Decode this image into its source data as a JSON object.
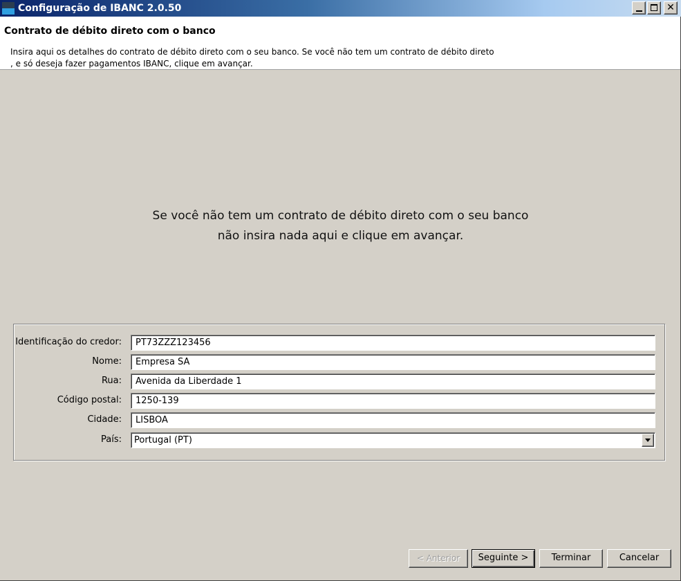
{
  "window": {
    "title": "Configuração de IBANC 2.0.50",
    "minimize_icon": "minimize-icon",
    "maximize_icon": "maximize-icon",
    "close_icon": "close-icon",
    "close_glyph": "✕"
  },
  "header": {
    "title": "Contrato de débito direto com o banco",
    "description_line1": "Insira aqui os detalhes do contrato de débito direto com o seu banco. Se você não tem um contrato de débito direto",
    "description_line2": ", e só deseja fazer pagamentos IBANC, clique em avançar."
  },
  "message": {
    "line1": "Se você não tem um contrato de débito direto com o seu banco",
    "line2": "não insira nada aqui e clique em avançar."
  },
  "form": {
    "creditor_id": {
      "label": "Identificação do credor:",
      "value": "PT73ZZZ123456"
    },
    "name": {
      "label": "Nome:",
      "value": "Empresa SA"
    },
    "street": {
      "label": "Rua:",
      "value": "Avenida da Liberdade 1"
    },
    "postal_code": {
      "label": "Código postal:",
      "value": "1250-139"
    },
    "city": {
      "label": "Cidade:",
      "value": "LISBOA"
    },
    "country": {
      "label": "País:",
      "value": "Portugal (PT)"
    }
  },
  "buttons": {
    "previous": "< Anterior",
    "next": "Seguinte >",
    "finish": "Terminar",
    "cancel": "Cancelar"
  },
  "colors": {
    "titlebar_start": "#0a246a",
    "titlebar_end": "#c8dcf0",
    "background": "#d4d0c8"
  }
}
